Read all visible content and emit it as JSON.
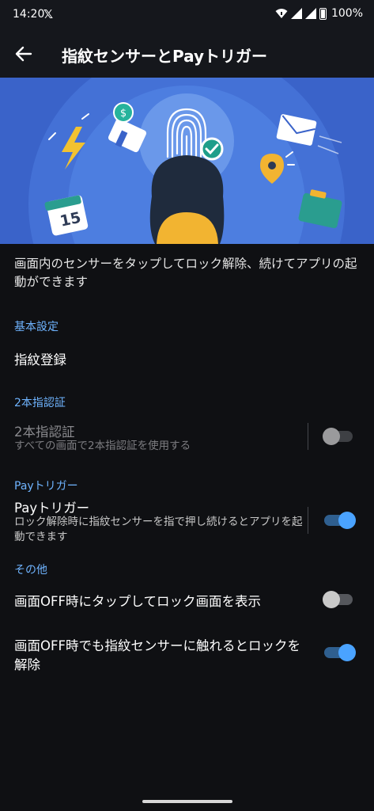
{
  "status_bar": {
    "time": "14:20",
    "x_app": "𝕏",
    "battery_percent": "100%"
  },
  "app_bar": {
    "title": "指紋センサーとPayトリガー",
    "back_icon": "arrow-left-icon"
  },
  "hero": {
    "calendar_day": "15",
    "coin_symbol": "$"
  },
  "description": "画面内のセンサーをタップしてロック解除、続けてアプリの起動ができます",
  "sections": {
    "basic": {
      "header": "基本設定",
      "fingerprint_register": "指紋登録"
    },
    "two_finger": {
      "header": "2本指認証",
      "title": "2本指認証",
      "subtitle": "すべての画面で2本指認証を使用する",
      "enabled": false,
      "disabled": true
    },
    "pay_trigger": {
      "header": "Payトリガー",
      "title": "Payトリガー",
      "subtitle": "ロック解除時に指紋センサーを指で押し続けるとアプリを起動できます",
      "enabled": true
    },
    "other": {
      "header": "その他",
      "screen_off_tap": {
        "title": "画面OFF時にタップしてロック画面を表示",
        "enabled": false
      },
      "screen_off_unlock": {
        "title": "画面OFF時でも指紋センサーに触れるとロックを解除",
        "enabled": true
      }
    }
  },
  "colors": {
    "accent": "#4aa3ff",
    "section_header": "#6fb4ff",
    "background": "#0f1013",
    "hero_bg": "#3a63c9"
  }
}
